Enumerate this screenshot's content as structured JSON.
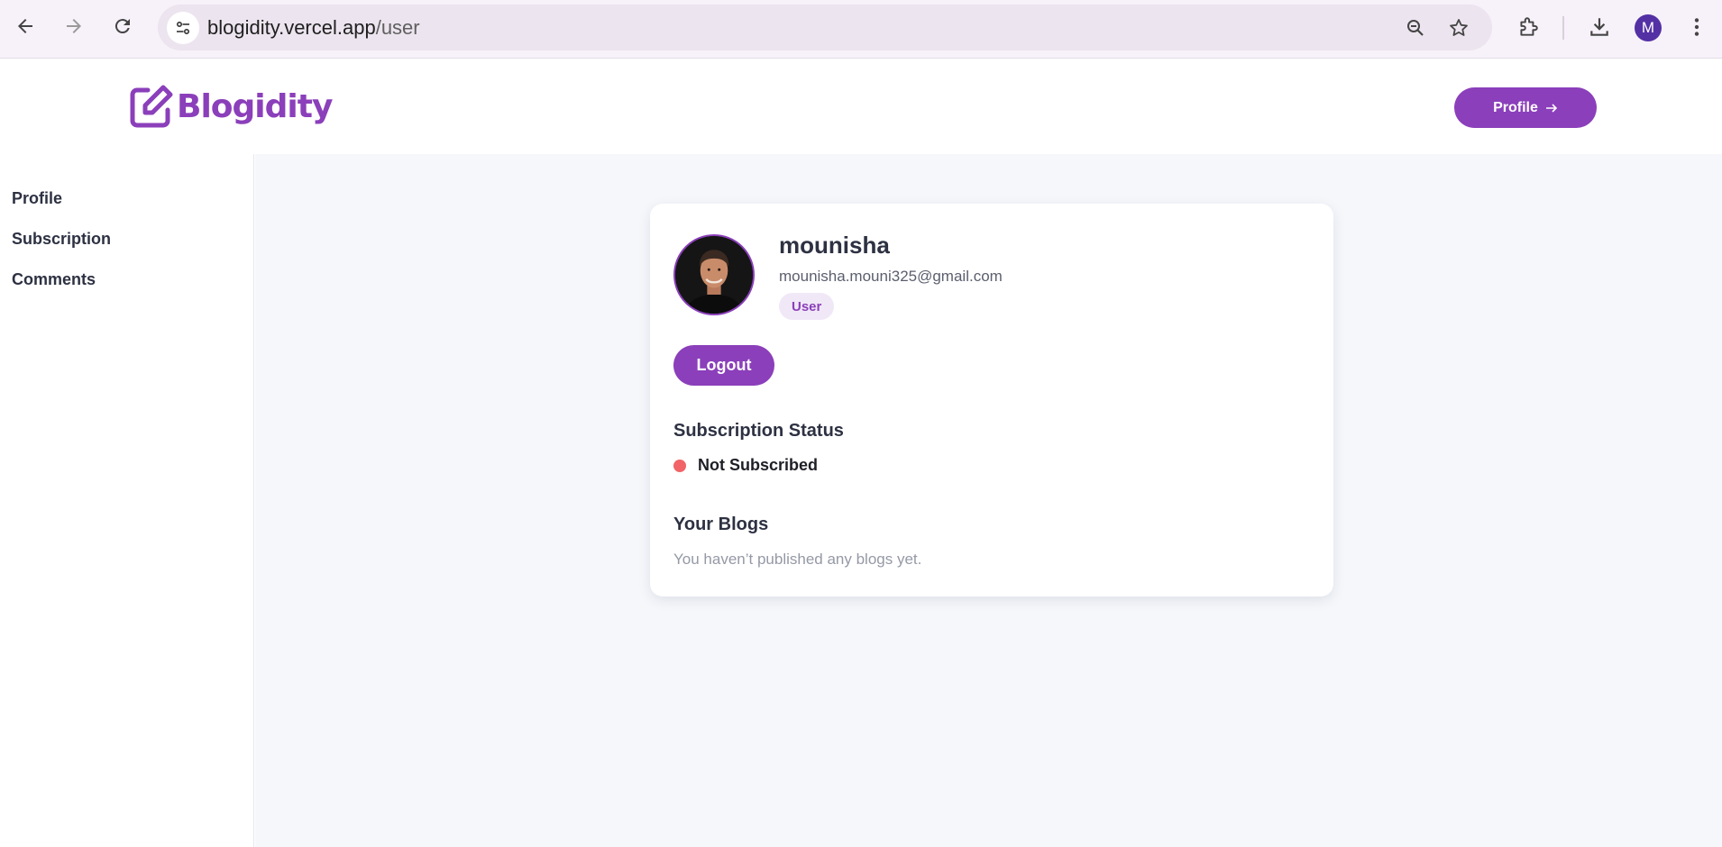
{
  "browser": {
    "url_domain": "blogidity.vercel.app",
    "url_path": "/user",
    "account_initial": "M",
    "icons": [
      "back-icon",
      "forward-icon",
      "reload-icon",
      "site-info-icon",
      "zoom-icon",
      "star-icon",
      "extensions-icon",
      "download-icon",
      "menu-icon"
    ]
  },
  "header": {
    "logo_text": "Blogidity",
    "logo_icon": "edit-square-icon",
    "profile_button": "Profile",
    "profile_button_icon": "arrow-right-icon"
  },
  "sidebar": {
    "items": [
      {
        "label": "Profile"
      },
      {
        "label": "Subscription"
      },
      {
        "label": "Comments"
      }
    ]
  },
  "profile": {
    "username": "mounisha",
    "email": "mounisha.mouni325@gmail.com",
    "role": "User",
    "logout_label": "Logout"
  },
  "subscription": {
    "title": "Subscription Status",
    "status": "Not Subscribed",
    "status_color": "#f16366"
  },
  "blogs": {
    "title": "Your Blogs",
    "empty_message": "You haven’t published any blogs yet."
  },
  "colors": {
    "brand": "#8b3fba",
    "main_background": "#f5f7fb",
    "text": "#2d3142"
  }
}
